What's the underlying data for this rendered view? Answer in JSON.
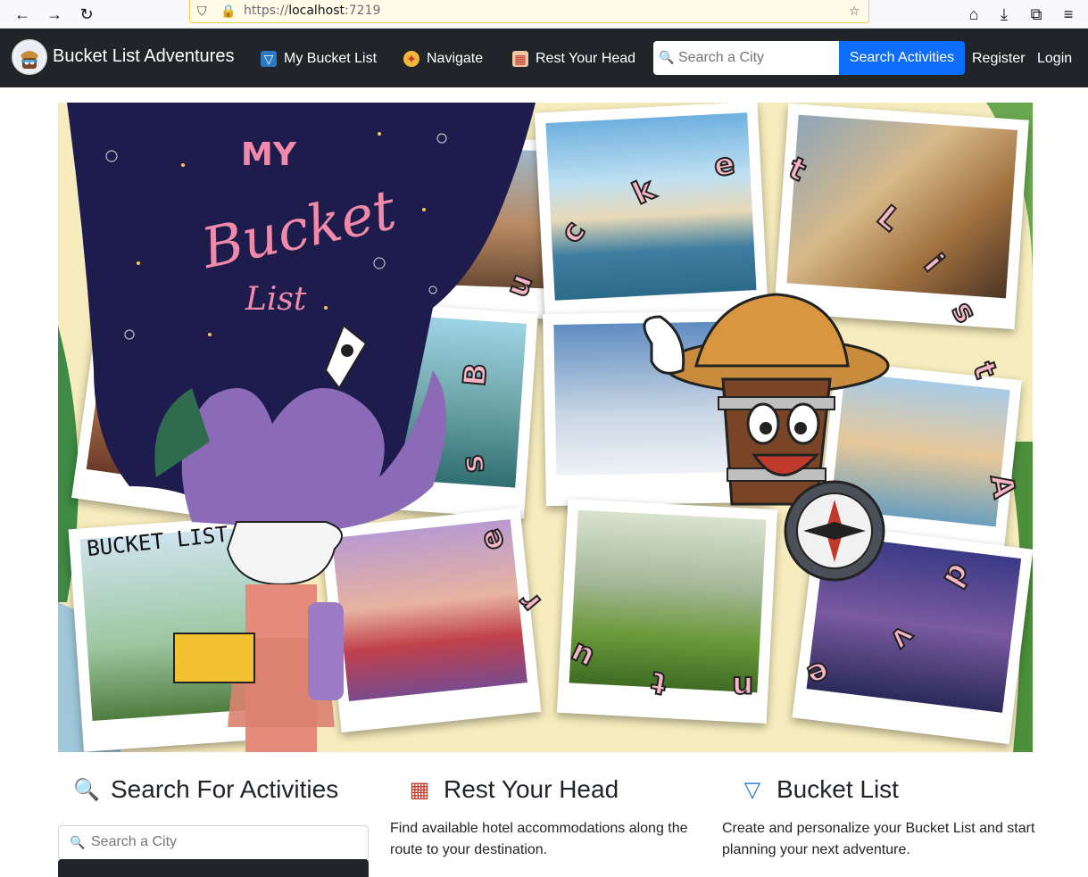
{
  "browser": {
    "url_prefix": "https://",
    "url_host": "localhost",
    "url_port": ":7219",
    "back_icon": "arrow-left",
    "forward_icon": "arrow-right",
    "reload_icon": "reload"
  },
  "navbar": {
    "brand": "Bucket List Adventures",
    "links": [
      {
        "label": "My Bucket List",
        "icon": "bucket-icon"
      },
      {
        "label": "Navigate",
        "icon": "compass-icon"
      },
      {
        "label": "Rest Your Head",
        "icon": "hotel-icon"
      }
    ],
    "search_placeholder": "Search a City",
    "search_button": "Search Activities",
    "register": "Register",
    "login": "Login"
  },
  "hero": {
    "title_letters": [
      "B",
      "u",
      "c",
      "k",
      "e",
      "t",
      "L",
      "i",
      "s",
      "t",
      "A",
      "d",
      "v",
      "e",
      "n",
      "t",
      "u",
      "r",
      "e",
      "s"
    ],
    "poster_lines": [
      "MY",
      "Bucket",
      "List"
    ],
    "card_caption": "BUCKET LIST"
  },
  "features": [
    {
      "title": "Search For Activities",
      "icon": "search-icon",
      "placeholder": "Search a City"
    },
    {
      "title": "Rest Your Head",
      "icon": "hotel-icon",
      "description": "Find available hotel accommodations along the route to your destination."
    },
    {
      "title": "Bucket List",
      "icon": "bucket-icon",
      "description": "Create and personalize your Bucket List and start planning your next adventure."
    }
  ],
  "colors": {
    "navbar_bg": "#212529",
    "primary": "#0d6efd",
    "letter_fill": "#f7b6c6"
  }
}
